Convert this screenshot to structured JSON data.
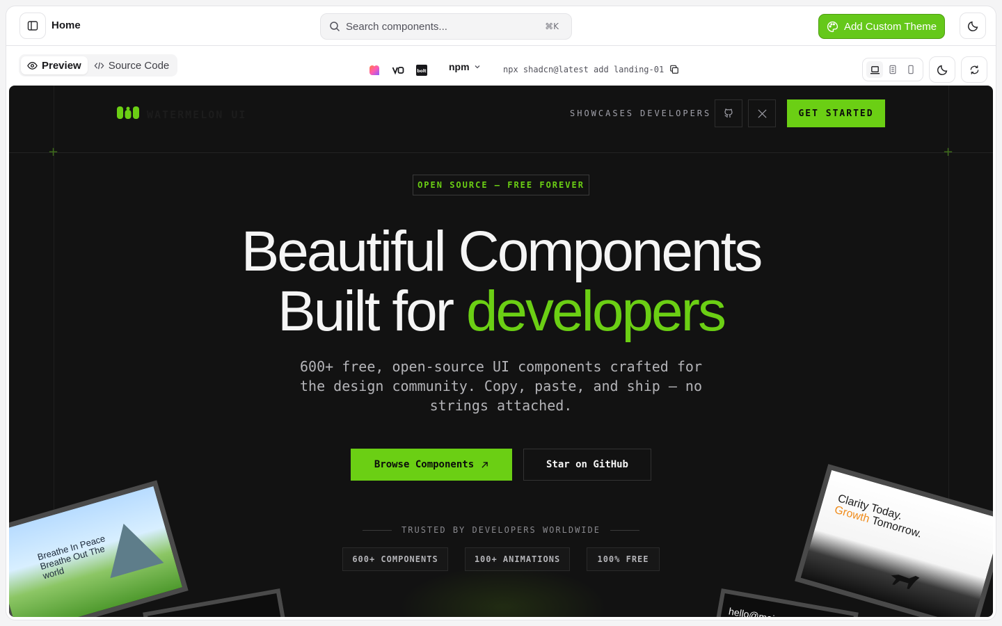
{
  "topbar": {
    "home_label": "Home",
    "search_placeholder": "Search components...",
    "search_shortcut": "⌘K",
    "add_theme_label": "Add Custom Theme"
  },
  "subbar": {
    "tabs": [
      {
        "label": "Preview",
        "icon": "eye-icon",
        "active": true
      },
      {
        "label": "Source Code",
        "icon": "code-icon",
        "active": false
      }
    ],
    "package_manager": "npm",
    "install_command": "npx shadcn@latest add landing-01"
  },
  "preview": {
    "brand_name": "WATERMELON UI",
    "nav": [
      "SHOWCASES",
      "DEVELOPERS"
    ],
    "get_started": "GET STARTED",
    "badge": "OPEN SOURCE — FREE FOREVER",
    "headline_line1": "Beautiful Components",
    "headline_line2_prefix": "Built for ",
    "headline_line2_accent": "developers",
    "subcopy": "600+ free, open-source UI components crafted for the design community. Copy, paste, and ship — no strings attached.",
    "browse_label": "Browse Components",
    "star_label": "Star on GitHub",
    "trusted_label": "TRUSTED BY DEVELOPERS WORLDWIDE",
    "stats": [
      "600+ COMPONENTS",
      "100+ ANIMATIONS",
      "100% FREE"
    ],
    "card_left_text": "Breathe In Peace Breathe Out The world",
    "card_right_line1": "Clarity Today.",
    "card_right_line2_accent": "Growth",
    "card_right_line2_rest": " Tomorrow.",
    "card_right2_text": "hello@mai"
  },
  "colors": {
    "accent": "#6bcf14",
    "preview_bg": "#121212",
    "theme_button": "#65c81a"
  }
}
